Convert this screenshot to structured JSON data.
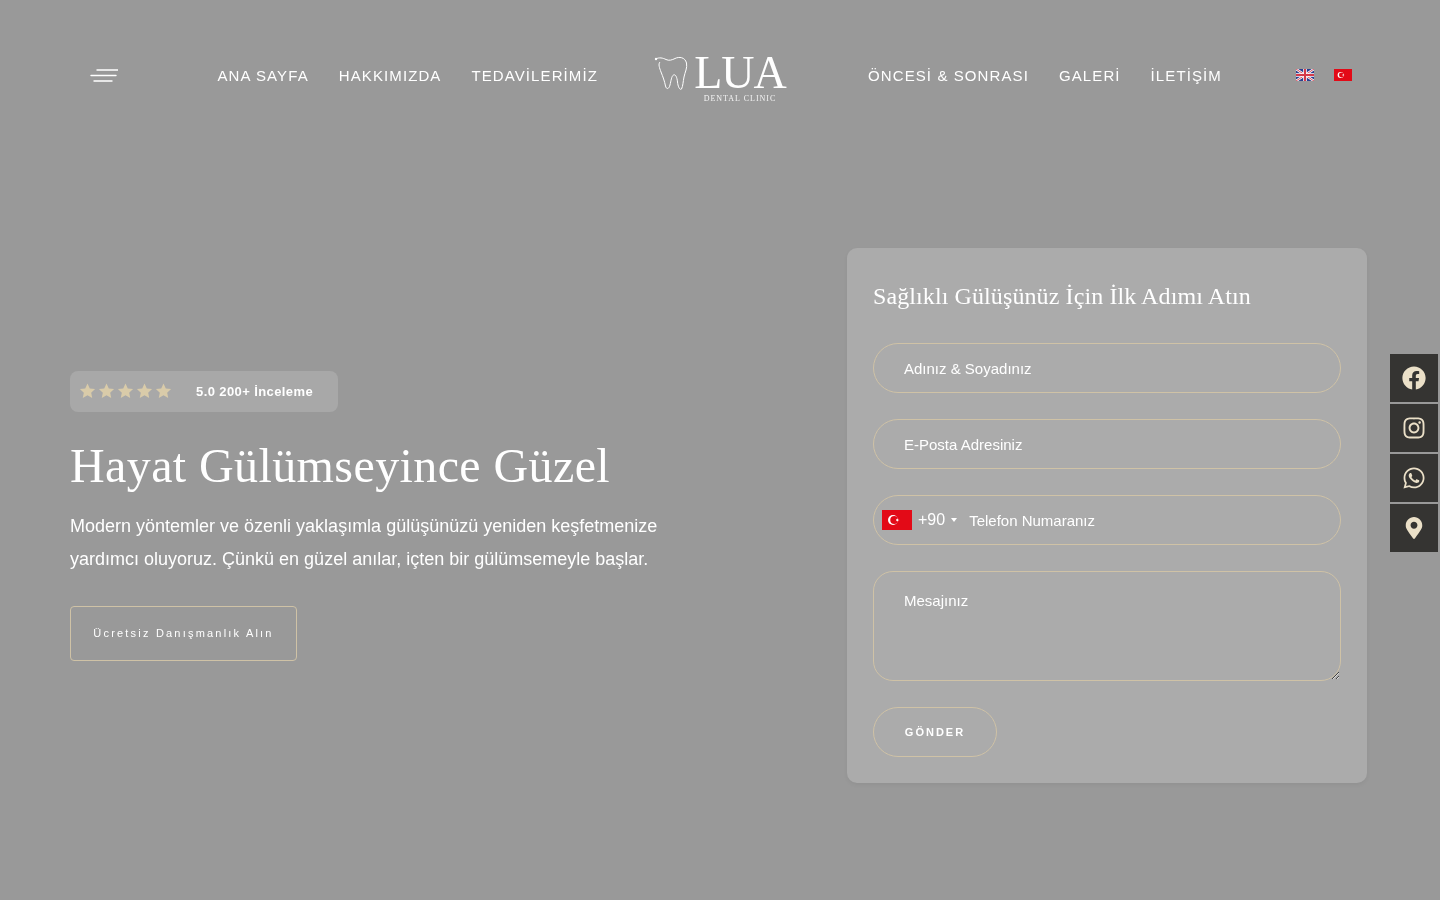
{
  "header": {
    "nav_left": [
      "ANA SAYFA",
      "HAKKIMIZDA",
      "TEDAVİLERİMİZ"
    ],
    "logo": {
      "name": "LUA",
      "tagline": "DENTAL CLINIC"
    },
    "nav_right": [
      "ÖNCESİ & SONRASI",
      "GALERİ",
      "İLETİŞİM"
    ]
  },
  "hero": {
    "rating": {
      "stars": 5,
      "label": "5.0 200+ İnceleme"
    },
    "title": "Hayat Gülümseyince Güzel",
    "description": "Modern yöntemler ve özenli yaklaşımla gülüşünüzü yeniden keşfetmenize yardımcı oluyoruz. Çünkü en güzel anılar, içten bir gülümsemeyle başlar.",
    "cta": "Ücretsiz Danışmanlık Alın"
  },
  "form": {
    "title": "Sağlıklı Gülüşünüz İçin İlk Adımı Atın",
    "fields": [
      {
        "kind": "text",
        "placeholder": "Adınız & Soyadınız"
      },
      {
        "kind": "email",
        "placeholder": "E-Posta Adresiniz"
      },
      {
        "kind": "phone",
        "dial_code": "+90",
        "placeholder": "Telefon Numaranız"
      },
      {
        "kind": "textarea",
        "placeholder": "Mesajınız"
      }
    ],
    "submit": "GÖNDER"
  }
}
